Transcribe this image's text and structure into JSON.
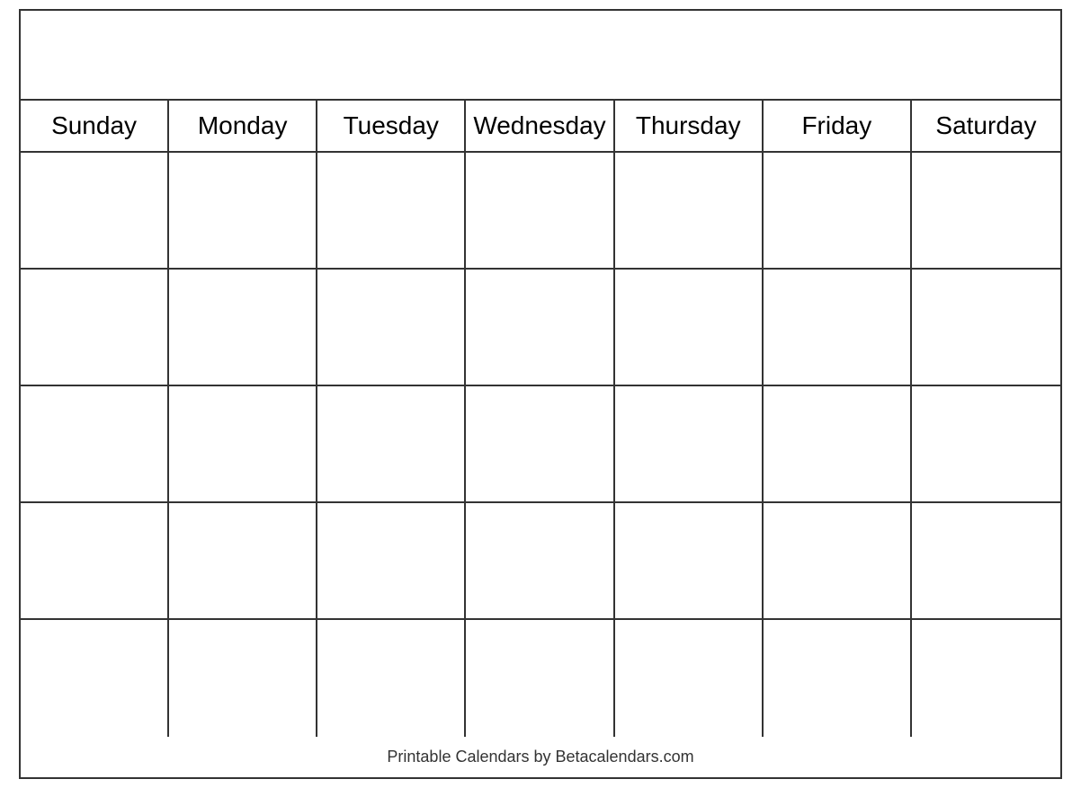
{
  "calendar": {
    "title": "",
    "days": [
      "Sunday",
      "Monday",
      "Tuesday",
      "Wednesday",
      "Thursday",
      "Friday",
      "Saturday"
    ],
    "weeks": [
      [
        "",
        "",
        "",
        "",
        "",
        "",
        ""
      ],
      [
        "",
        "",
        "",
        "",
        "",
        "",
        ""
      ],
      [
        "",
        "",
        "",
        "",
        "",
        "",
        ""
      ],
      [
        "",
        "",
        "",
        "",
        "",
        "",
        ""
      ],
      [
        "",
        "",
        "",
        "",
        "",
        "",
        ""
      ]
    ],
    "footer": "Printable Calendars by Betacalendars.com"
  }
}
